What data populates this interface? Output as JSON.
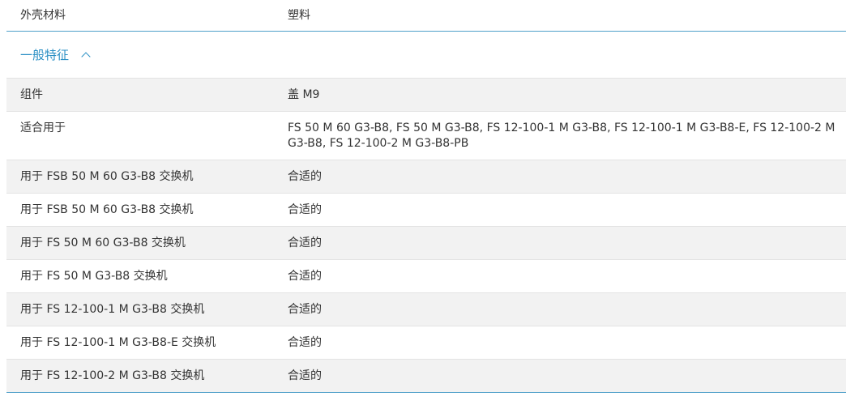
{
  "top_row": {
    "label": "外壳材料",
    "value": "塑料"
  },
  "section": {
    "title": "一般特征"
  },
  "rows": [
    {
      "label": "组件",
      "value": "盖 M9"
    },
    {
      "label": "适合用于",
      "value": "FS 50 M 60 G3-B8, FS 50 M G3-B8, FS 12-100-1 M G3-B8, FS 12-100-1 M G3-B8-E, FS 12-100-2 M G3-B8, FS 12-100-2 M G3-B8-PB"
    },
    {
      "label": "用于 FSB 50 M 60 G3-B8 交换机",
      "value": "合适的"
    },
    {
      "label": "用于 FSB 50 M 60 G3-B8 交换机",
      "value": "合适的"
    },
    {
      "label": "用于 FS 50 M 60 G3-B8 交换机",
      "value": "合适的"
    },
    {
      "label": "用于 FS 50 M G3-B8 交换机",
      "value": "合适的"
    },
    {
      "label": "用于 FS 12-100-1 M G3-B8 交换机",
      "value": "合适的"
    },
    {
      "label": "用于 FS 12-100-1 M G3-B8-E 交换机",
      "value": "合适的"
    },
    {
      "label": "用于 FS 12-100-2 M G3-B8 交换机",
      "value": "合适的"
    }
  ],
  "colors": {
    "accent": "#2a8fc4",
    "border": "#4fa0c9",
    "shade": "#f2f2f2"
  },
  "icons": {
    "section_toggle": "chevron-up-icon"
  }
}
